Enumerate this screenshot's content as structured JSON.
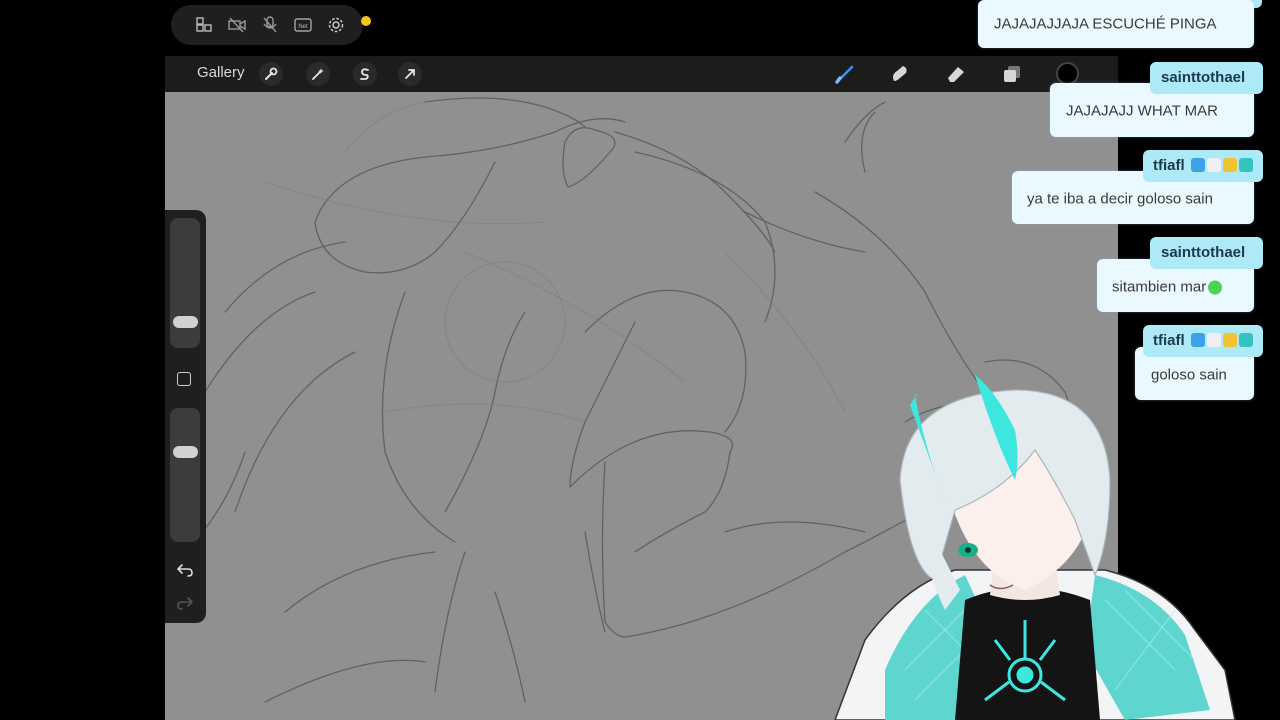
{
  "toolbar": {
    "gallery_label": "Gallery"
  },
  "icons": {
    "status": [
      "screen-record-icon",
      "no-camera-icon",
      "no-mic-icon",
      "network-icon",
      "settings-gear-icon"
    ],
    "network_label": "Net",
    "toolbar_left": [
      "wrench-icon",
      "magic-wand-icon",
      "selection-s-icon",
      "transform-arrow-icon"
    ],
    "toolbar_right": [
      "brush-icon",
      "smudge-icon",
      "eraser-icon",
      "layers-icon"
    ]
  },
  "colors": {
    "brush_active": "#3a8fff",
    "current_color": "#000000",
    "chat_name_bg": "#aee9f7",
    "chat_bubble_bg": "#eaf9ff"
  },
  "chat": {
    "m1_text": "JAJAJAJJAJA ESCUCHÉ PINGA",
    "m2_name": "sainttothael",
    "m2_text": "JAJAJAJJ WHAT MAR",
    "m3_name": "tfiafl",
    "m3_text": "ya te iba a decir goloso sain",
    "m4_name": "sainttothael",
    "m4_text": "sitambien mar",
    "m5_name": "tfiafl",
    "m5_text": "goloso sain"
  }
}
